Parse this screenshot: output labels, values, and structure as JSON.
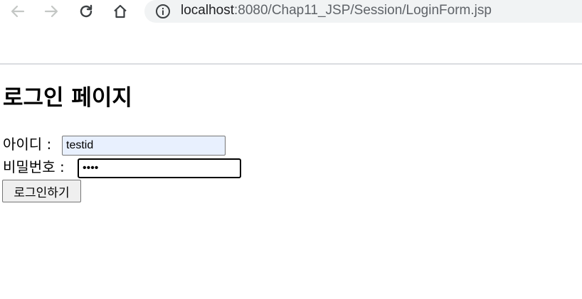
{
  "browser": {
    "back_icon": "arrow-left-icon",
    "forward_icon": "arrow-right-icon",
    "reload_icon": "reload-icon",
    "home_icon": "home-icon",
    "site_info_icon": "info-icon",
    "url_host": "localhost",
    "url_rest": ":8080/Chap11_JSP/Session/LoginForm.jsp"
  },
  "page": {
    "title": "로그인 페이지",
    "id_label": "아이디 :",
    "id_value": "testid",
    "password_label": "비밀번호 :",
    "password_value": "••••",
    "login_button": "로그인하기"
  },
  "colors": {
    "autofill_background": "#e8f0fe",
    "omnibox_background": "#f1f3f4"
  }
}
